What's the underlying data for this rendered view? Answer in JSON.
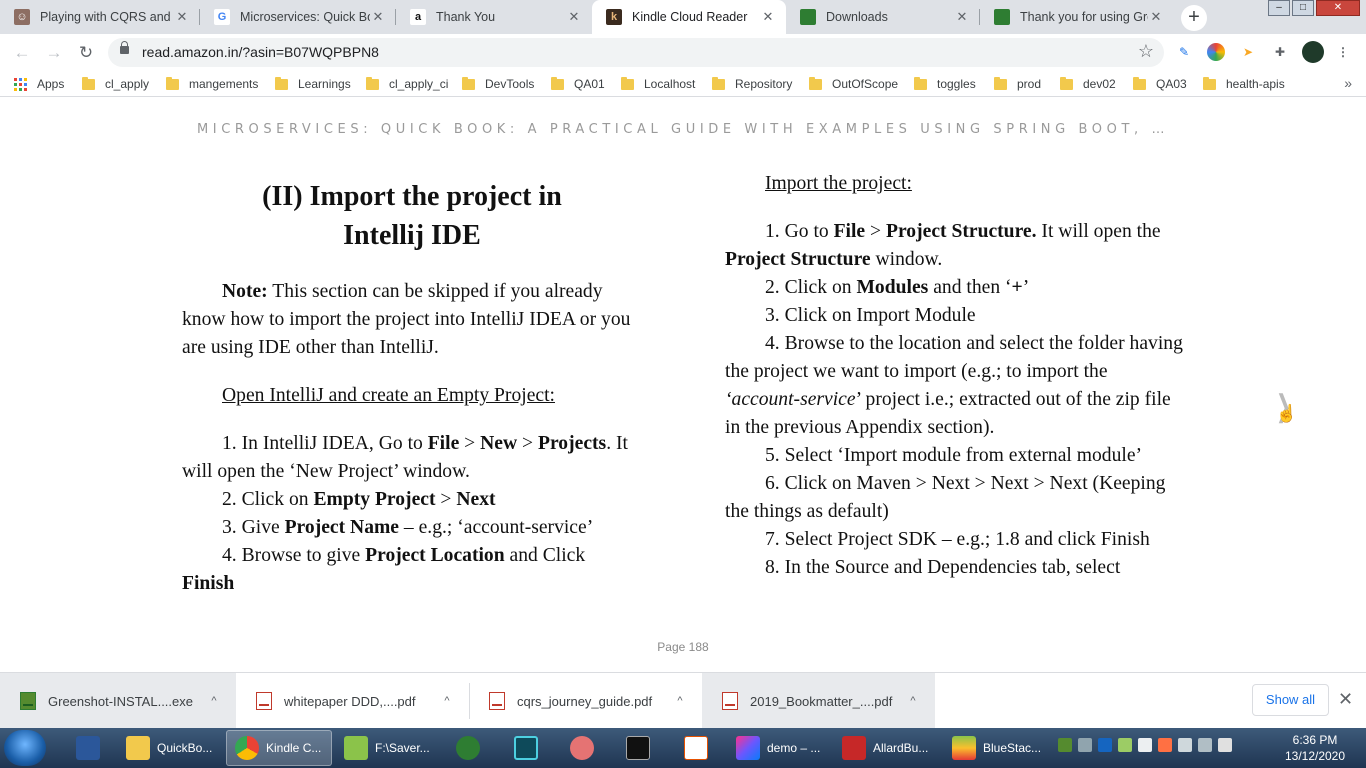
{
  "browser": {
    "tabs": [
      {
        "title": "Playing with CQRS and E",
        "favicon": "person-avatar-icon",
        "active": false
      },
      {
        "title": "Microservices: Quick Boo",
        "favicon": "google-icon",
        "active": false
      },
      {
        "title": "Thank You",
        "favicon": "amazon-icon",
        "active": false
      },
      {
        "title": "Kindle Cloud Reader",
        "favicon": "kindle-icon",
        "active": true
      },
      {
        "title": "Downloads",
        "favicon": "greenshot-icon",
        "active": false
      },
      {
        "title": "Thank you for using Gre",
        "favicon": "greenshot-icon",
        "active": false
      }
    ],
    "close_glyph": "✕",
    "new_tab_glyph": "+",
    "url": "read.amazon.in/?asin=B07WQPBPN8",
    "bookmarks": [
      "Apps",
      "cl_apply",
      "mangements",
      "Learnings",
      "cl_apply_ci",
      "DevTools",
      "QA01",
      "Localhost",
      "Repository",
      "OutOfScope",
      "toggles",
      "prod",
      "dev02",
      "QA03",
      "health-apis"
    ],
    "bookmarks_overflow": "»",
    "accent": "#1a73e8"
  },
  "reader": {
    "book_title": "MICROSERVICES: QUICK BOOK: A PRACTICAL GUIDE WITH EXAMPLES USING SPRING BOOT, …",
    "page_label": "Page 188",
    "next_glyph": "❯",
    "left": {
      "heading_line1": "(II) Import the project in",
      "heading_line2": "Intellij IDE",
      "note_label": "Note:",
      "note_text": " This section can be skipped if you already know how to import the project into IntelliJ IDEA or you are using IDE other than IntelliJ.",
      "subheading": "Open IntelliJ and create an Empty Project:",
      "s1_a": "1. In IntelliJ IDEA, Go to ",
      "s1_b": "File",
      "s1_c": " > ",
      "s1_d": "New",
      "s1_e": " > ",
      "s1_f": "Projects",
      "s1_g": ". It will open the ‘New Project’ window.",
      "s2_a": "2. Click on ",
      "s2_b": "Empty Project",
      "s2_c": " > ",
      "s2_d": "Next",
      "s3_a": "3. Give ",
      "s3_b": "Project Name",
      "s3_c": " – e.g.; ‘account-service’",
      "s4_a": "4. Browse to give ",
      "s4_b": "Project Location",
      "s4_c": " and Click ",
      "s4_d": "Finish"
    },
    "right": {
      "subheading": "Import the project:",
      "s1_a": "1. Go to ",
      "s1_b": "File",
      "s1_c": " > ",
      "s1_d": "Project Structure.",
      "s1_e": " It will open the ",
      "s1_f": "Project Structure",
      "s1_g": " window.",
      "s2_a": "2. Click on ",
      "s2_b": "Modules",
      "s2_c": " and then ‘",
      "s2_d": "+",
      "s2_e": "’",
      "s3": "3. Click on Import Module",
      "s4_a": "4. Browse to the location and select the folder having the project we want to import (e.g.; to import the ",
      "s4_b": "‘account-service",
      "s4_c": "’ project i.e.; extracted out of the zip file in the previous Appendix section).",
      "s5": "5. Select ‘Import module from external module’",
      "s6": "6. Click on Maven > Next > Next > Next (Keeping the things as default)",
      "s7": "7. Select Project SDK – e.g.; 1.8 and click Finish",
      "s8": "8. In the Source and Dependencies tab, select"
    }
  },
  "downloads": {
    "items": [
      {
        "name": "Greenshot-INSTAL....exe",
        "type": "exe"
      },
      {
        "name": "whitepaper DDD,....pdf",
        "type": "pdf"
      },
      {
        "name": "cqrs_journey_guide.pdf",
        "type": "pdf"
      },
      {
        "name": "2019_Bookmatter_....pdf",
        "type": "pdf"
      }
    ],
    "caret_glyph": "^",
    "show_all": "Show all",
    "close_glyph": "✕"
  },
  "taskbar": {
    "items": [
      {
        "label": "",
        "icon": "word-icon"
      },
      {
        "label": "QuickBo...",
        "icon": "folder-icon"
      },
      {
        "label": "Kindle C...",
        "icon": "chrome-icon"
      },
      {
        "label": "F:\\Saver...",
        "icon": "notepad-icon"
      },
      {
        "label": "",
        "icon": "timer-icon"
      },
      {
        "label": "",
        "icon": "editor-icon"
      },
      {
        "label": "",
        "icon": "snipping-tool-icon"
      },
      {
        "label": "",
        "icon": "cmd-icon"
      },
      {
        "label": "",
        "icon": "java-icon"
      },
      {
        "label": "demo – ...",
        "icon": "intellij-icon"
      },
      {
        "label": "AllardBu...",
        "icon": "pdf-reader-icon"
      },
      {
        "label": "BlueStac...",
        "icon": "bluestacks-icon"
      }
    ],
    "time": "6:36 PM",
    "date": "13/12/2020"
  }
}
